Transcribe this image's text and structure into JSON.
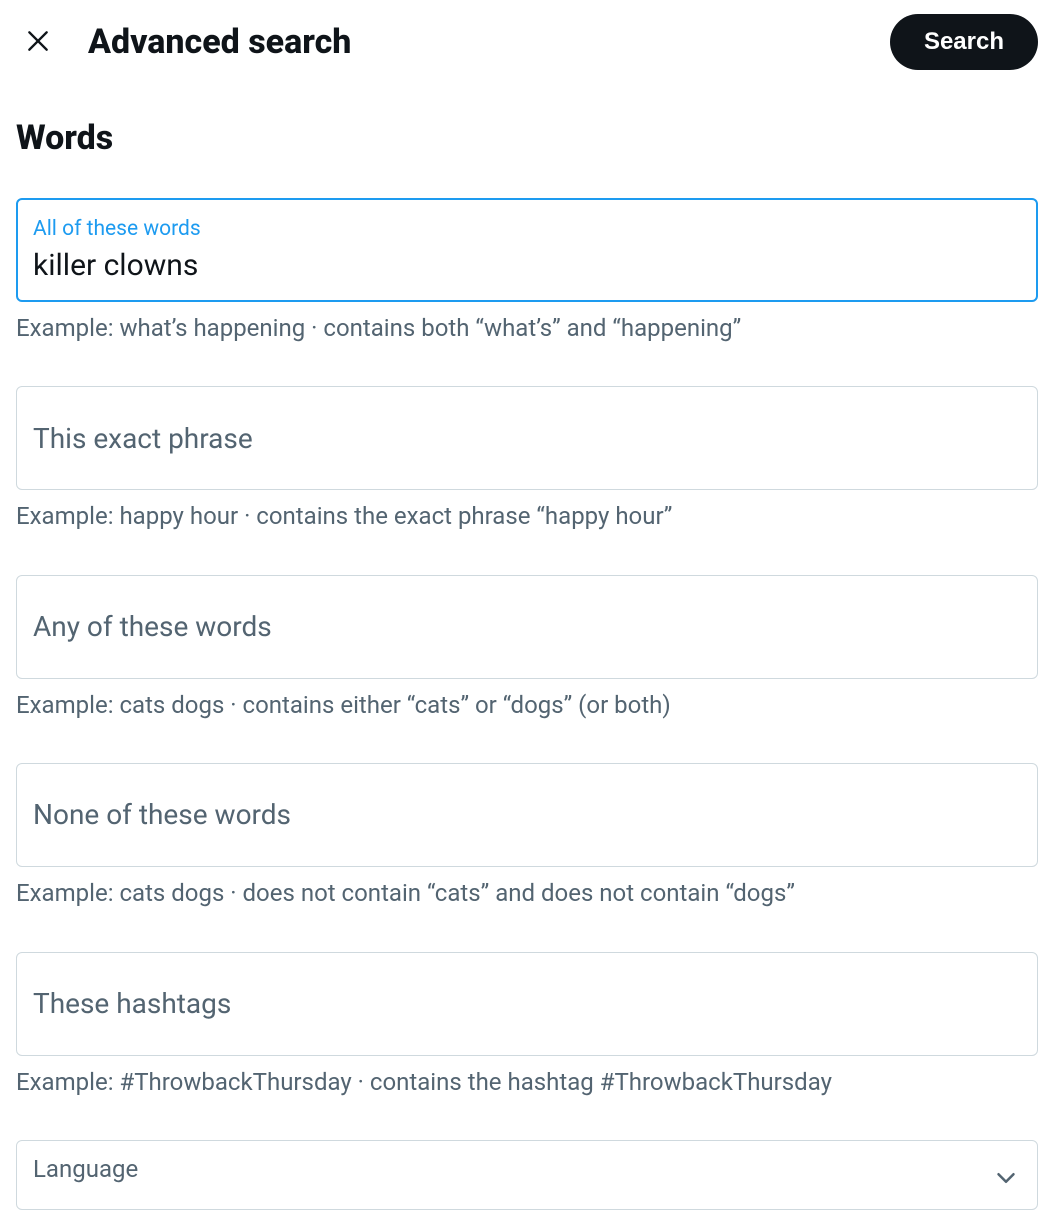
{
  "header": {
    "title": "Advanced search",
    "search_button": "Search"
  },
  "section": {
    "words_title": "Words"
  },
  "fields": {
    "all_words": {
      "label": "All of these words",
      "value": "killer clowns",
      "example": "Example: what’s happening · contains both “what’s” and “happening”"
    },
    "exact_phrase": {
      "label": "This exact phrase",
      "value": "",
      "example": "Example: happy hour · contains the exact phrase “happy hour”"
    },
    "any_words": {
      "label": "Any of these words",
      "value": "",
      "example": "Example: cats dogs · contains either “cats” or “dogs” (or both)"
    },
    "none_words": {
      "label": "None of these words",
      "value": "",
      "example": "Example: cats dogs · does not contain “cats” and does not contain “dogs”"
    },
    "hashtags": {
      "label": "These hashtags",
      "value": "",
      "example": "Example: #ThrowbackThursday · contains the hashtag #ThrowbackThursday"
    },
    "language": {
      "label": "Language"
    }
  }
}
